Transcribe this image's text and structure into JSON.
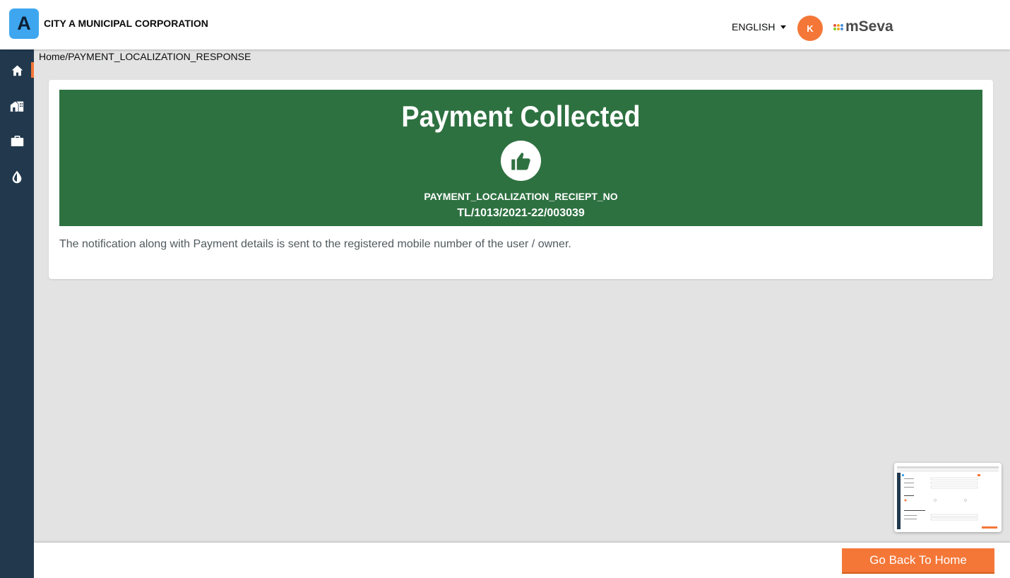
{
  "header": {
    "logo_letter": "A",
    "city_name": "CITY A MUNICIPAL CORPORATION",
    "language": "ENGLISH",
    "avatar_initial": "K",
    "brand": "mSeva"
  },
  "sidebar": {
    "items": [
      {
        "icon": "home-icon"
      },
      {
        "icon": "property-icon"
      },
      {
        "icon": "briefcase-icon"
      },
      {
        "icon": "water-drop-icon"
      }
    ]
  },
  "breadcrumb": {
    "home": "Home",
    "separator": "/",
    "current": "PAYMENT_LOCALIZATION_RESPONSE"
  },
  "banner": {
    "title": "Payment Collected",
    "icon": "thumbs-up-icon",
    "receipt_label": "PAYMENT_LOCALIZATION_RECIEPT_NO",
    "receipt_number": "TL/1013/2021-22/003039"
  },
  "notice": "The notification along with Payment details is sent to the registered mobile number of the user / owner.",
  "footer": {
    "go_home_label": "Go Back To Home"
  },
  "colors": {
    "accent": "#f47738",
    "sidebar": "#22394d",
    "success_banner": "#2e7141",
    "logo": "#3ea6ef"
  }
}
